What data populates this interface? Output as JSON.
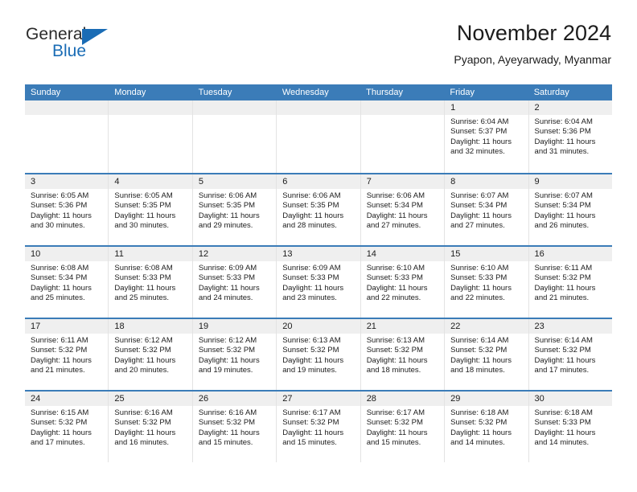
{
  "logo": {
    "word1": "General",
    "word2": "Blue",
    "triangle_color": "#1a6cb5"
  },
  "header": {
    "title": "November 2024",
    "subtitle": "Pyapon, Ayeyarwady, Myanmar"
  },
  "theme": {
    "header_blue": "#3b7cb8",
    "daynum_bg": "#efefef",
    "cell_border": "#e3e3e3"
  },
  "weekday_headers": [
    "Sunday",
    "Monday",
    "Tuesday",
    "Wednesday",
    "Thursday",
    "Friday",
    "Saturday"
  ],
  "weeks": [
    [
      {
        "day": "",
        "empty": true
      },
      {
        "day": "",
        "empty": true
      },
      {
        "day": "",
        "empty": true
      },
      {
        "day": "",
        "empty": true
      },
      {
        "day": "",
        "empty": true
      },
      {
        "day": "1",
        "sunrise": "Sunrise: 6:04 AM",
        "sunset": "Sunset: 5:37 PM",
        "daylight": "Daylight: 11 hours and 32 minutes."
      },
      {
        "day": "2",
        "sunrise": "Sunrise: 6:04 AM",
        "sunset": "Sunset: 5:36 PM",
        "daylight": "Daylight: 11 hours and 31 minutes."
      }
    ],
    [
      {
        "day": "3",
        "sunrise": "Sunrise: 6:05 AM",
        "sunset": "Sunset: 5:36 PM",
        "daylight": "Daylight: 11 hours and 30 minutes."
      },
      {
        "day": "4",
        "sunrise": "Sunrise: 6:05 AM",
        "sunset": "Sunset: 5:35 PM",
        "daylight": "Daylight: 11 hours and 30 minutes."
      },
      {
        "day": "5",
        "sunrise": "Sunrise: 6:06 AM",
        "sunset": "Sunset: 5:35 PM",
        "daylight": "Daylight: 11 hours and 29 minutes."
      },
      {
        "day": "6",
        "sunrise": "Sunrise: 6:06 AM",
        "sunset": "Sunset: 5:35 PM",
        "daylight": "Daylight: 11 hours and 28 minutes."
      },
      {
        "day": "7",
        "sunrise": "Sunrise: 6:06 AM",
        "sunset": "Sunset: 5:34 PM",
        "daylight": "Daylight: 11 hours and 27 minutes."
      },
      {
        "day": "8",
        "sunrise": "Sunrise: 6:07 AM",
        "sunset": "Sunset: 5:34 PM",
        "daylight": "Daylight: 11 hours and 27 minutes."
      },
      {
        "day": "9",
        "sunrise": "Sunrise: 6:07 AM",
        "sunset": "Sunset: 5:34 PM",
        "daylight": "Daylight: 11 hours and 26 minutes."
      }
    ],
    [
      {
        "day": "10",
        "sunrise": "Sunrise: 6:08 AM",
        "sunset": "Sunset: 5:34 PM",
        "daylight": "Daylight: 11 hours and 25 minutes."
      },
      {
        "day": "11",
        "sunrise": "Sunrise: 6:08 AM",
        "sunset": "Sunset: 5:33 PM",
        "daylight": "Daylight: 11 hours and 25 minutes."
      },
      {
        "day": "12",
        "sunrise": "Sunrise: 6:09 AM",
        "sunset": "Sunset: 5:33 PM",
        "daylight": "Daylight: 11 hours and 24 minutes."
      },
      {
        "day": "13",
        "sunrise": "Sunrise: 6:09 AM",
        "sunset": "Sunset: 5:33 PM",
        "daylight": "Daylight: 11 hours and 23 minutes."
      },
      {
        "day": "14",
        "sunrise": "Sunrise: 6:10 AM",
        "sunset": "Sunset: 5:33 PM",
        "daylight": "Daylight: 11 hours and 22 minutes."
      },
      {
        "day": "15",
        "sunrise": "Sunrise: 6:10 AM",
        "sunset": "Sunset: 5:33 PM",
        "daylight": "Daylight: 11 hours and 22 minutes."
      },
      {
        "day": "16",
        "sunrise": "Sunrise: 6:11 AM",
        "sunset": "Sunset: 5:32 PM",
        "daylight": "Daylight: 11 hours and 21 minutes."
      }
    ],
    [
      {
        "day": "17",
        "sunrise": "Sunrise: 6:11 AM",
        "sunset": "Sunset: 5:32 PM",
        "daylight": "Daylight: 11 hours and 21 minutes."
      },
      {
        "day": "18",
        "sunrise": "Sunrise: 6:12 AM",
        "sunset": "Sunset: 5:32 PM",
        "daylight": "Daylight: 11 hours and 20 minutes."
      },
      {
        "day": "19",
        "sunrise": "Sunrise: 6:12 AM",
        "sunset": "Sunset: 5:32 PM",
        "daylight": "Daylight: 11 hours and 19 minutes."
      },
      {
        "day": "20",
        "sunrise": "Sunrise: 6:13 AM",
        "sunset": "Sunset: 5:32 PM",
        "daylight": "Daylight: 11 hours and 19 minutes."
      },
      {
        "day": "21",
        "sunrise": "Sunrise: 6:13 AM",
        "sunset": "Sunset: 5:32 PM",
        "daylight": "Daylight: 11 hours and 18 minutes."
      },
      {
        "day": "22",
        "sunrise": "Sunrise: 6:14 AM",
        "sunset": "Sunset: 5:32 PM",
        "daylight": "Daylight: 11 hours and 18 minutes."
      },
      {
        "day": "23",
        "sunrise": "Sunrise: 6:14 AM",
        "sunset": "Sunset: 5:32 PM",
        "daylight": "Daylight: 11 hours and 17 minutes."
      }
    ],
    [
      {
        "day": "24",
        "sunrise": "Sunrise: 6:15 AM",
        "sunset": "Sunset: 5:32 PM",
        "daylight": "Daylight: 11 hours and 17 minutes."
      },
      {
        "day": "25",
        "sunrise": "Sunrise: 6:16 AM",
        "sunset": "Sunset: 5:32 PM",
        "daylight": "Daylight: 11 hours and 16 minutes."
      },
      {
        "day": "26",
        "sunrise": "Sunrise: 6:16 AM",
        "sunset": "Sunset: 5:32 PM",
        "daylight": "Daylight: 11 hours and 15 minutes."
      },
      {
        "day": "27",
        "sunrise": "Sunrise: 6:17 AM",
        "sunset": "Sunset: 5:32 PM",
        "daylight": "Daylight: 11 hours and 15 minutes."
      },
      {
        "day": "28",
        "sunrise": "Sunrise: 6:17 AM",
        "sunset": "Sunset: 5:32 PM",
        "daylight": "Daylight: 11 hours and 15 minutes."
      },
      {
        "day": "29",
        "sunrise": "Sunrise: 6:18 AM",
        "sunset": "Sunset: 5:32 PM",
        "daylight": "Daylight: 11 hours and 14 minutes."
      },
      {
        "day": "30",
        "sunrise": "Sunrise: 6:18 AM",
        "sunset": "Sunset: 5:33 PM",
        "daylight": "Daylight: 11 hours and 14 minutes."
      }
    ]
  ]
}
